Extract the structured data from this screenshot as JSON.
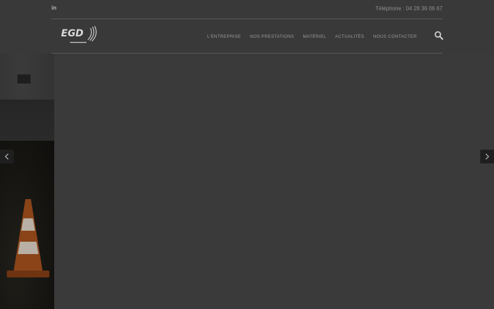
{
  "topbar": {
    "social_label": "in",
    "phone_text": "Téléphone : 04 28 36 06 67"
  },
  "logo": {
    "brand": "EGD"
  },
  "nav": {
    "items": [
      {
        "label": "L'ENTREPRISE"
      },
      {
        "label": "NOS PRESTATIONS"
      },
      {
        "label": "MATÉRIEL"
      },
      {
        "label": "ACTUALITÉS"
      },
      {
        "label": "NOUS CONTACTER"
      }
    ]
  },
  "icons": {
    "social": "linkedin-icon",
    "search": "search-icon",
    "prev": "chevron-left-icon",
    "next": "chevron-right-icon"
  },
  "colors": {
    "overlay": "#3a3a3a",
    "nav_text": "#9a9a9a",
    "rule": "#5a5a5a",
    "arrow_bg": "#1f1f1f"
  }
}
